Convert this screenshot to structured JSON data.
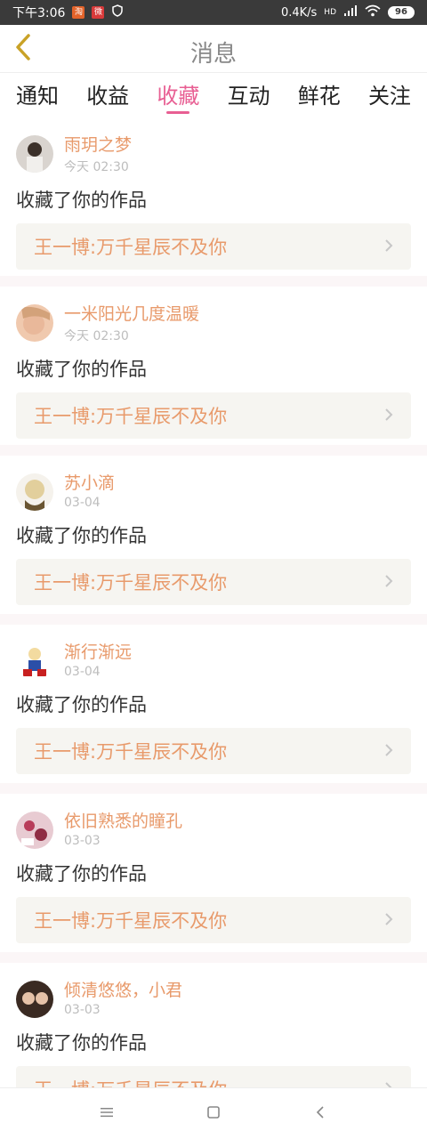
{
  "status_bar": {
    "time": "下午3:06",
    "app_icon_1": "淘",
    "app_icon_2": "微",
    "network_speed": "0.4K/s",
    "network_type": "HD",
    "battery": "96"
  },
  "header": {
    "title": "消息",
    "back_icon": "chevron-left-icon"
  },
  "tabs": [
    {
      "label": "通知",
      "active": false
    },
    {
      "label": "收益",
      "active": false
    },
    {
      "label": "收藏",
      "active": true
    },
    {
      "label": "互动",
      "active": false
    },
    {
      "label": "鲜花",
      "active": false
    },
    {
      "label": "关注",
      "active": false
    }
  ],
  "messages": [
    {
      "user": "雨玥之梦",
      "time": "今天 02:30",
      "action": "收藏了你的作品",
      "work": "王一博:万千星辰不及你"
    },
    {
      "user": "一米阳光几度温暖",
      "time": "今天 02:30",
      "action": "收藏了你的作品",
      "work": "王一博:万千星辰不及你"
    },
    {
      "user": "苏小滴",
      "time": "03-04",
      "action": "收藏了你的作品",
      "work": "王一博:万千星辰不及你"
    },
    {
      "user": "渐行渐远",
      "time": "03-04",
      "action": "收藏了你的作品",
      "work": "王一博:万千星辰不及你"
    },
    {
      "user": "依旧熟悉的瞳孔",
      "time": "03-03",
      "action": "收藏了你的作品",
      "work": "王一博:万千星辰不及你"
    },
    {
      "user": "倾清悠悠，小君",
      "time": "03-03",
      "action": "收藏了你的作品",
      "work": "王一博:万千星辰不及你"
    }
  ],
  "colors": {
    "accent": "#e85f93",
    "username": "#e89a6b",
    "link_bg": "#f6f5f1"
  },
  "navbar": {
    "icons": [
      "menu-icon",
      "home-icon",
      "back-icon"
    ]
  }
}
